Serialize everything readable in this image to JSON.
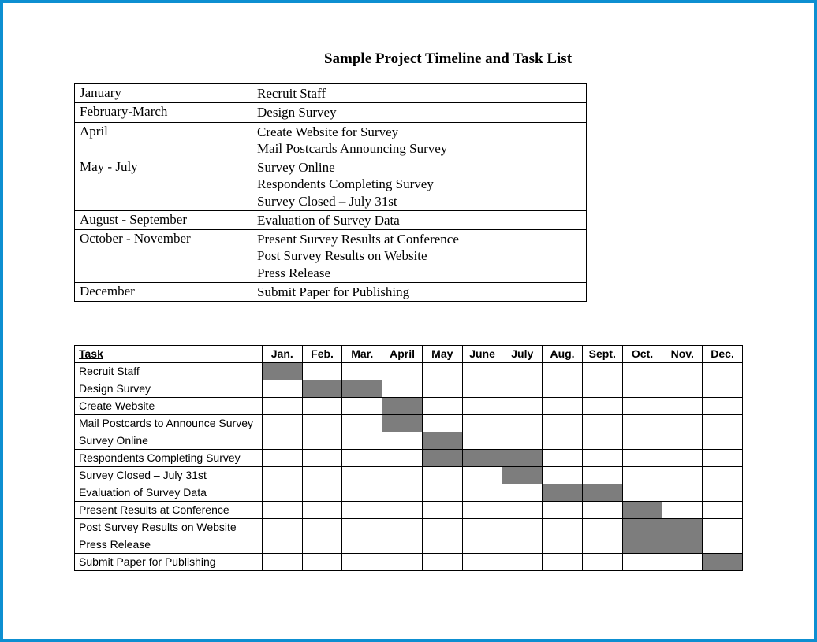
{
  "title": "Sample Project Timeline and Task List",
  "timeline": [
    {
      "period": "January",
      "tasks": [
        "Recruit Staff"
      ]
    },
    {
      "period": "February-March",
      "tasks": [
        "Design Survey"
      ]
    },
    {
      "period": "April",
      "tasks": [
        "Create Website for Survey",
        "Mail Postcards Announcing Survey"
      ]
    },
    {
      "period": "May - July",
      "tasks": [
        "Survey Online",
        "Respondents Completing Survey",
        "Survey Closed – July 31st"
      ]
    },
    {
      "period": "August - September",
      "tasks": [
        "Evaluation of Survey Data"
      ]
    },
    {
      "period": "October - November",
      "tasks": [
        "Present Survey Results at Conference",
        "Post Survey Results on Website",
        "Press Release"
      ]
    },
    {
      "period": "December",
      "tasks": [
        "Submit Paper for Publishing"
      ]
    }
  ],
  "gantt": {
    "task_header": "Task",
    "months": [
      "Jan.",
      "Feb.",
      "Mar.",
      "April",
      "May",
      "June",
      "July",
      "Aug.",
      "Sept.",
      "Oct.",
      "Nov.",
      "Dec."
    ],
    "rows": [
      {
        "task": "Recruit Staff",
        "fill": [
          1
        ]
      },
      {
        "task": "Design Survey",
        "fill": [
          2,
          3
        ]
      },
      {
        "task": "Create Website",
        "fill": [
          4
        ]
      },
      {
        "task": "Mail Postcards to Announce Survey",
        "fill": [
          4
        ]
      },
      {
        "task": "Survey Online",
        "fill": [
          5
        ]
      },
      {
        "task": "Respondents Completing Survey",
        "fill": [
          5,
          6,
          7
        ]
      },
      {
        "task": "Survey Closed – July 31st",
        "fill": [
          7
        ]
      },
      {
        "task": "Evaluation of Survey Data",
        "fill": [
          8,
          9
        ]
      },
      {
        "task": "Present Results at Conference",
        "fill": [
          10
        ]
      },
      {
        "task": "Post Survey Results on Website",
        "fill": [
          10,
          11
        ]
      },
      {
        "task": "Press Release",
        "fill": [
          10,
          11
        ]
      },
      {
        "task": "Submit Paper for Publishing",
        "fill": [
          12
        ]
      }
    ]
  },
  "chart_data": {
    "type": "table",
    "title": "Sample Project Timeline and Task List",
    "months": [
      "Jan",
      "Feb",
      "Mar",
      "Apr",
      "May",
      "Jun",
      "Jul",
      "Aug",
      "Sep",
      "Oct",
      "Nov",
      "Dec"
    ],
    "tasks": [
      {
        "name": "Recruit Staff",
        "months": [
          1
        ]
      },
      {
        "name": "Design Survey",
        "months": [
          2,
          3
        ]
      },
      {
        "name": "Create Website",
        "months": [
          4
        ]
      },
      {
        "name": "Mail Postcards to Announce Survey",
        "months": [
          4
        ]
      },
      {
        "name": "Survey Online",
        "months": [
          5
        ]
      },
      {
        "name": "Respondents Completing Survey",
        "months": [
          5,
          6,
          7
        ]
      },
      {
        "name": "Survey Closed – July 31st",
        "months": [
          7
        ]
      },
      {
        "name": "Evaluation of Survey Data",
        "months": [
          8,
          9
        ]
      },
      {
        "name": "Present Results at Conference",
        "months": [
          10
        ]
      },
      {
        "name": "Post Survey Results on Website",
        "months": [
          10,
          11
        ]
      },
      {
        "name": "Press Release",
        "months": [
          10,
          11
        ]
      },
      {
        "name": "Submit Paper for Publishing",
        "months": [
          12
        ]
      }
    ]
  }
}
